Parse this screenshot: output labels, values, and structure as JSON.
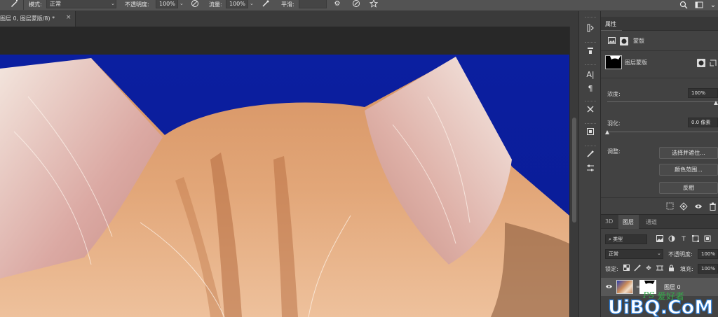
{
  "options_bar": {
    "mode_label": "模式:",
    "mode_value": "正常",
    "opacity_label": "不透明度:",
    "opacity_value": "100%",
    "flow_label": "流量:",
    "flow_value": "100%",
    "smoothing_label": "平滑:"
  },
  "document_tab": {
    "title": "图层 0, 图层蒙版/8) *",
    "close": "×"
  },
  "properties_panel": {
    "title": "属性",
    "section_label": "蒙版",
    "mask_name": "图层蒙版",
    "density_label": "浓度:",
    "density_value": "100%",
    "density_fraction": 1.0,
    "feather_label": "羽化:",
    "feather_value": "0.0 像素",
    "feather_fraction": 0.0,
    "adjust_label": "调整:",
    "buttons": [
      "选择并遮住...",
      "颜色范围...",
      "反相"
    ]
  },
  "layers_panel": {
    "tabs": [
      "3D",
      "图层",
      "通道"
    ],
    "active_tab": 1,
    "filter_value": "类型",
    "blend_mode": "正常",
    "opacity_label": "不透明度:",
    "opacity_value": "100%",
    "lock_label": "锁定:",
    "fill_label": "填充:",
    "fill_value": "100%",
    "layer_name": "图层 0"
  },
  "watermark_text": "UiBQ.CoM",
  "colors": {
    "canvas_background": "#0b1fa0",
    "panel_bg": "#424242",
    "options_bar_bg": "#535353"
  }
}
